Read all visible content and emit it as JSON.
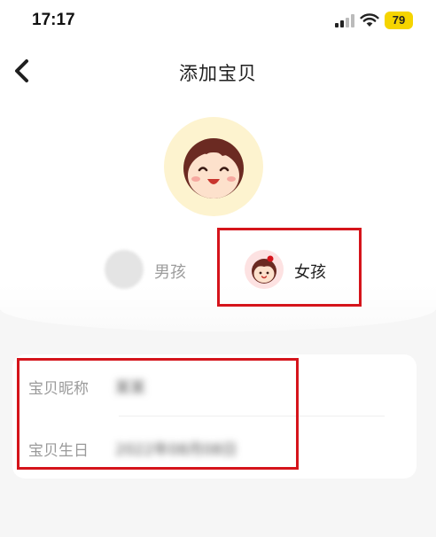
{
  "status_bar": {
    "time": "17:17",
    "battery": "79",
    "battery_color": "#f5d400",
    "icons": [
      "signal-icon",
      "wifi-icon"
    ]
  },
  "nav": {
    "back_icon": "chevron-left-icon",
    "title": "添加宝贝"
  },
  "avatar": {
    "icon": "baby-face-icon",
    "background": "#fdf3cf"
  },
  "gender": {
    "boy": {
      "label": "男孩",
      "selected": false
    },
    "girl": {
      "label": "女孩",
      "selected": true
    }
  },
  "form": {
    "nickname": {
      "label": "宝贝昵称",
      "value": "某某"
    },
    "birthday": {
      "label": "宝贝生日",
      "value": "2022年08月08日"
    }
  },
  "annotation_color": "#d5141b"
}
